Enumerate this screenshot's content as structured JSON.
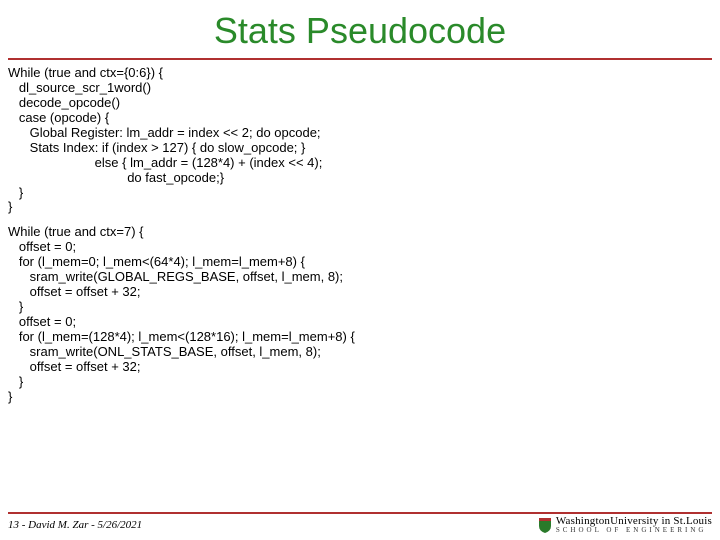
{
  "title": "Stats Pseudocode",
  "code1": "While (true and ctx={0:6}) {\n   dl_source_scr_1word()\n   decode_opcode()\n   case (opcode) {\n      Global Register: lm_addr = index << 2; do opcode;\n      Stats Index: if (index > 127) { do slow_opcode; }\n                        else { lm_addr = (128*4) + (index << 4);\n                                 do fast_opcode;}\n   }\n}",
  "code2": "While (true and ctx=7) {\n   offset = 0;\n   for (l_mem=0; l_mem<(64*4); l_mem=l_mem+8) {\n      sram_write(GLOBAL_REGS_BASE, offset, l_mem, 8);\n      offset = offset + 32;\n   }\n   offset = 0;\n   for (l_mem=(128*4); l_mem<(128*16); l_mem=l_mem+8) {\n      sram_write(ONL_STATS_BASE, offset, l_mem, 8);\n      offset = offset + 32;\n   }\n}",
  "footer": {
    "left": "13 - David M. Zar - 5/26/2021",
    "logo_top": "WashingtonUniversity in St.Louis",
    "logo_bottom": "SCHOOL OF ENGINEERING"
  }
}
